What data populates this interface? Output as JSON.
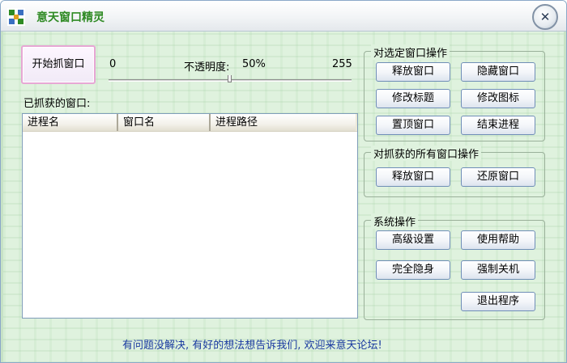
{
  "window": {
    "title": "意天窗口精灵",
    "close_glyph": "✕"
  },
  "capture": {
    "start_button": "开始抓窗口",
    "slider_min": "0",
    "slider_max": "255",
    "opacity_label": "不透明度:",
    "opacity_value": "50%",
    "opacity_fraction": 0.5
  },
  "captured": {
    "label": "已抓获的窗口:",
    "columns": [
      "进程名",
      "窗口名",
      "进程路径"
    ],
    "rows": []
  },
  "selected_ops": {
    "title": "对选定窗口操作",
    "buttons": [
      "释放窗口",
      "隐藏窗口",
      "修改标题",
      "修改图标",
      "置顶窗口",
      "结束进程"
    ]
  },
  "all_ops": {
    "title": "对抓获的所有窗口操作",
    "buttons": [
      "释放窗口",
      "还原窗口"
    ]
  },
  "system_ops": {
    "title": "系统操作",
    "buttons": [
      "高级设置",
      "使用帮助",
      "完全隐身",
      "强制关机",
      "退出程序"
    ]
  },
  "footer": {
    "text": "有问题没解决, 有好的想法想告诉我们, 欢迎来意天论坛!"
  },
  "colors": {
    "title_text": "#2f8a24",
    "client_bg": "#dff2de",
    "footer_text": "#1a3aa0",
    "button_border": "#6f8eb7"
  },
  "icons": {
    "app": "app-logo-icon",
    "close": "close-icon"
  }
}
